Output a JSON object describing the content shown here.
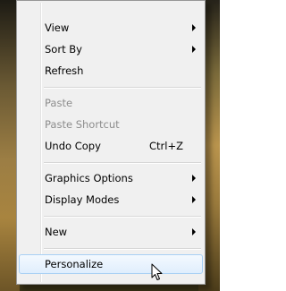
{
  "context_menu": {
    "items": [
      {
        "label": "View",
        "submenu": true
      },
      {
        "label": "Sort By",
        "submenu": true
      },
      {
        "label": "Refresh"
      },
      {
        "label": "Paste",
        "disabled": true
      },
      {
        "label": "Paste Shortcut",
        "disabled": true
      },
      {
        "label": "Undo Copy",
        "shortcut": "Ctrl+Z"
      },
      {
        "label": "Graphics Options",
        "submenu": true
      },
      {
        "label": "Display Modes",
        "submenu": true
      },
      {
        "label": "New",
        "submenu": true
      },
      {
        "label": "Personalize",
        "highlighted": true
      }
    ]
  },
  "colors": {
    "menu_background": "#f0f0f0",
    "disabled_text": "#8d8d8d",
    "highlight_border": "#a8d0f4"
  },
  "icons": {
    "submenu_arrow": "chevron-right-icon",
    "pointer": "mouse-cursor-icon"
  }
}
